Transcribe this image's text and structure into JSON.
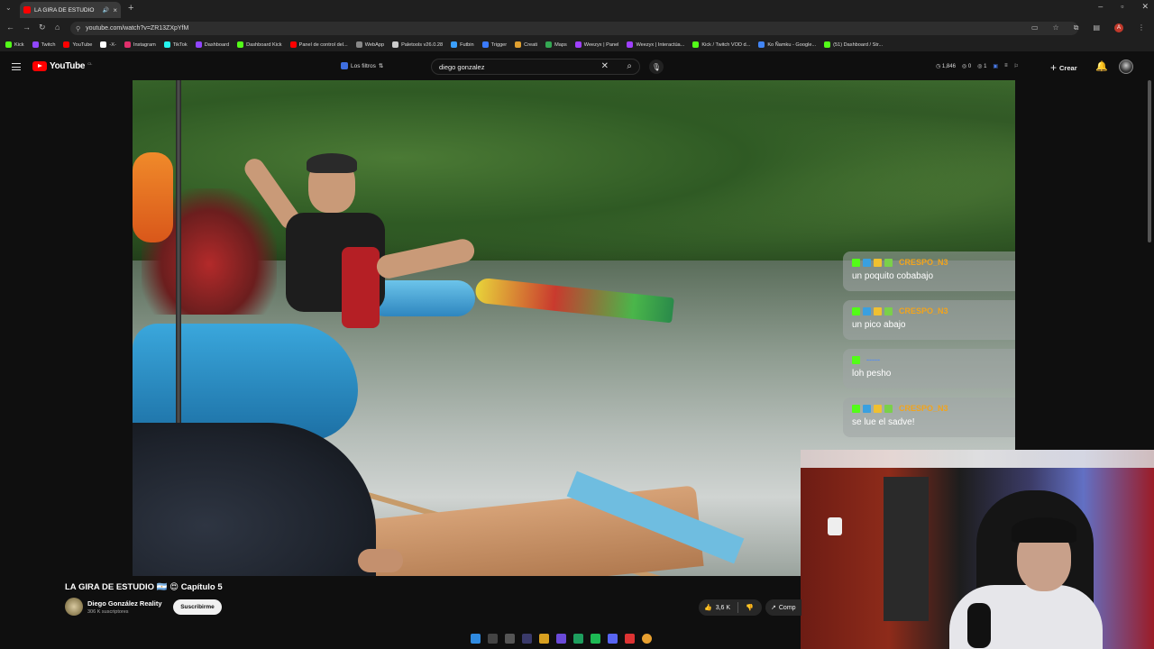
{
  "browser": {
    "tab_title": "LA GIRA DE ESTUDIO",
    "url": "youtube.com/watch?v=ZR13ZXpYfM",
    "bookmarks": [
      {
        "label": "Kick",
        "color": "#53fc18"
      },
      {
        "label": "Twitch",
        "color": "#9146ff"
      },
      {
        "label": "YouTube",
        "color": "#ff0000"
      },
      {
        "label": "-X-",
        "color": "#ffffff"
      },
      {
        "label": "Instagram",
        "color": "#e1306c"
      },
      {
        "label": "TikTok",
        "color": "#25f4ee"
      },
      {
        "label": "Dashboard",
        "color": "#9146ff"
      },
      {
        "label": "Dashboard Kick",
        "color": "#53fc18"
      },
      {
        "label": "Panel de control del...",
        "color": "#ff0000"
      },
      {
        "label": "WebApp",
        "color": "#888888"
      },
      {
        "label": "Paletools v26.0.28",
        "color": "#cccccc"
      },
      {
        "label": "Futbin",
        "color": "#3aa0ff"
      },
      {
        "label": "Trigger",
        "color": "#3a7bff"
      },
      {
        "label": "Creati",
        "color": "#e0a030"
      },
      {
        "label": "Maps",
        "color": "#34a853"
      },
      {
        "label": "Weezyx | Panel",
        "color": "#a040ff"
      },
      {
        "label": "Weezyx | Interactúa...",
        "color": "#a040ff"
      },
      {
        "label": "Kick / Twitch VOD d...",
        "color": "#53fc18"
      },
      {
        "label": "Ko Ñamku - Google...",
        "color": "#4285f4"
      },
      {
        "label": "(51) Dashboard / Str...",
        "color": "#53fc18"
      }
    ]
  },
  "yt": {
    "logo": "YouTube",
    "country": "CL",
    "filters_label": "Los filtros",
    "search_value": "diego gonzalez",
    "stats": [
      "1,846",
      "0",
      "1"
    ],
    "create_label": "Crear"
  },
  "chat": [
    {
      "user": "CRESPO_N3",
      "user_color": "orange",
      "text": "un poquito cobabajo"
    },
    {
      "user": "CRESPO_N3",
      "user_color": "orange",
      "text": "un pico abajo"
    },
    {
      "user": "-----",
      "user_color": "blue",
      "text": "loh pesho"
    },
    {
      "user": "CRESPO_N3",
      "user_color": "orange",
      "text": "se lue el sadve!"
    }
  ],
  "video": {
    "title": "LA GIRA DE ESTUDIO 🇦🇷 😍 Capítulo 5",
    "channel": "Diego González Reality",
    "subscribers": "306 K suscriptores",
    "subscribe_label": "Suscribirme",
    "likes": "3,6 K",
    "share_label": "Comp"
  }
}
